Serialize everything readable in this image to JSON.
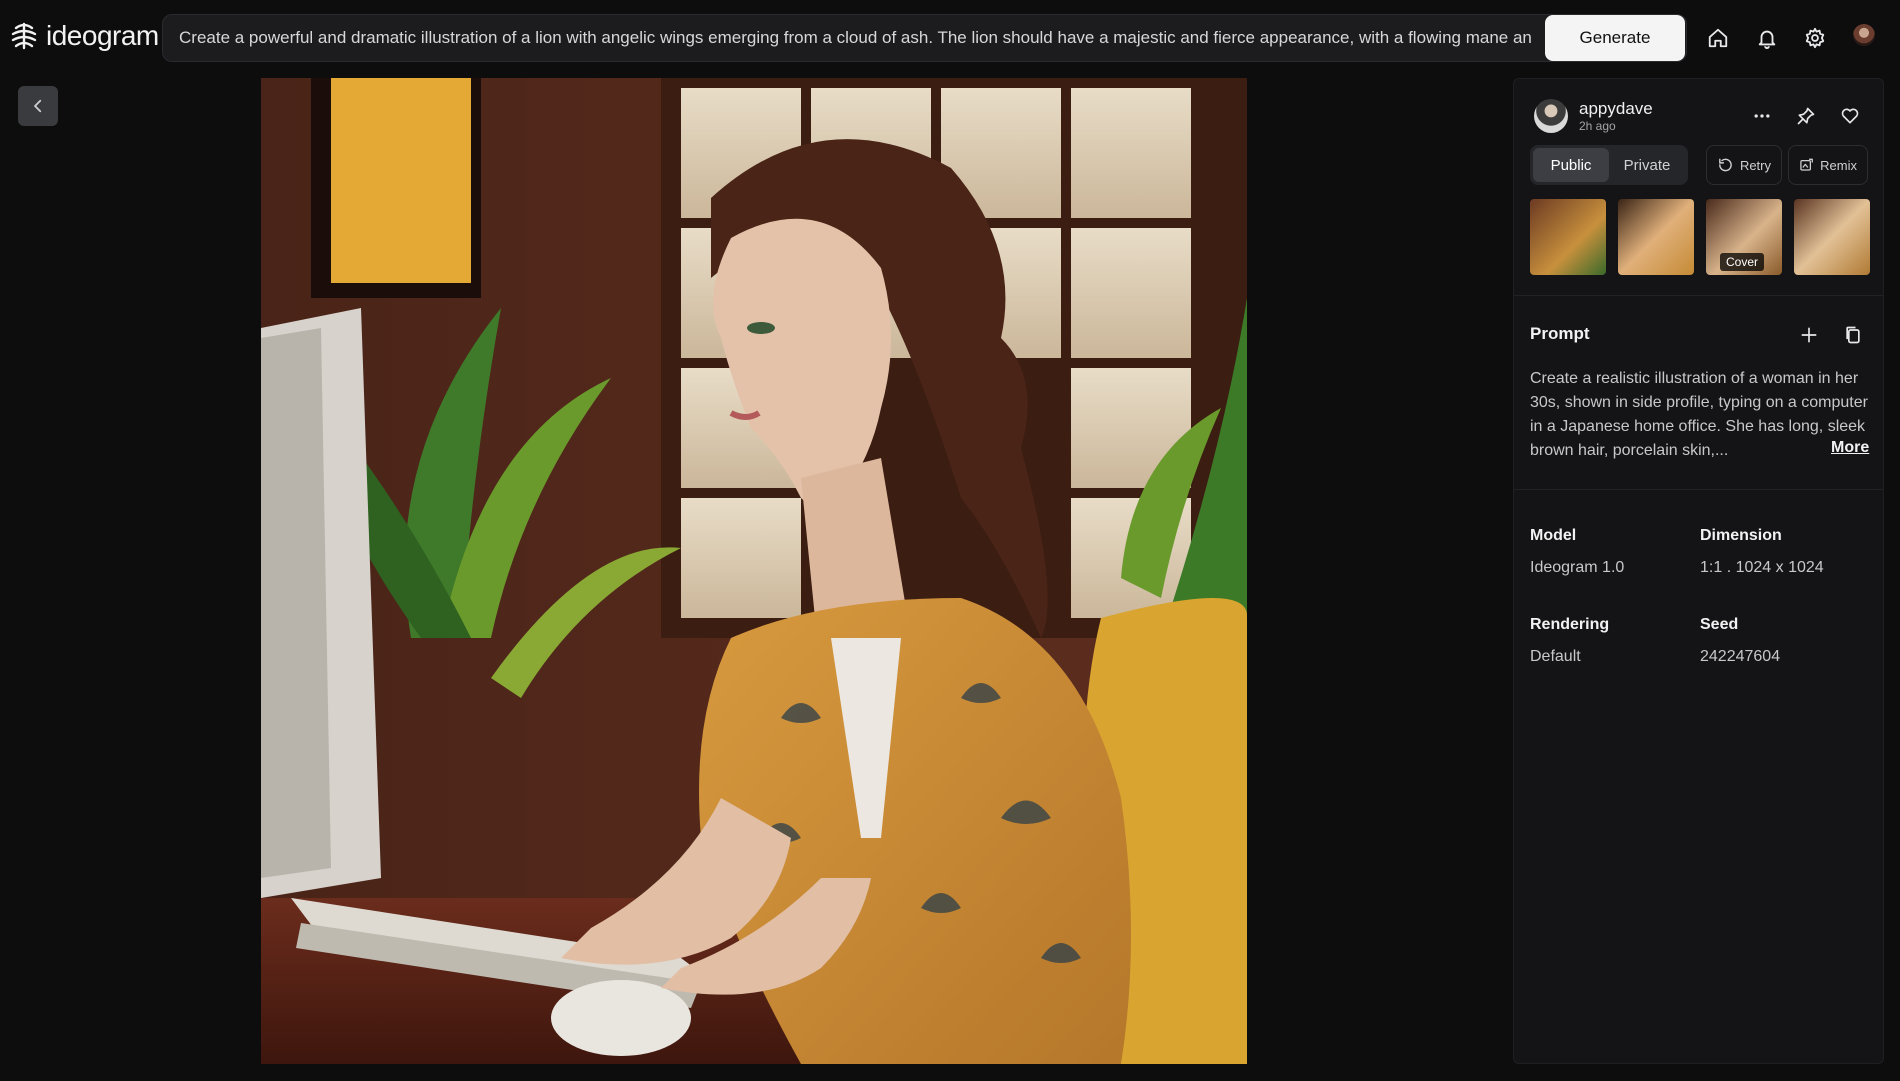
{
  "app": {
    "logo_text": "ideogram"
  },
  "topbar": {
    "prompt_value": "Create a powerful and dramatic illustration of a lion with angelic wings emerging from a cloud of ash. The lion should have a majestic and fierce appearance, with a flowing mane and detail",
    "generate_label": "Generate",
    "icons": [
      "home-icon",
      "bell-icon",
      "gear-icon",
      "avatar"
    ]
  },
  "panel": {
    "username": "appydave",
    "timeago": "2h ago",
    "visibility": {
      "public_label": "Public",
      "private_label": "Private",
      "selected": "Public"
    },
    "retry_label": "Retry",
    "remix_label": "Remix",
    "thumbnails": [
      {
        "label": ""
      },
      {
        "label": ""
      },
      {
        "label": "Cover"
      },
      {
        "label": ""
      }
    ],
    "prompt_heading": "Prompt",
    "prompt_text": "Create a realistic illustration of a woman in her 30s, shown in side profile, typing on a computer in a Japanese home office. She has long, sleek brown hair, porcelain skin,...",
    "more_label": "More",
    "meta": {
      "model_label": "Model",
      "model_value": "Ideogram 1.0",
      "dimension_label": "Dimension",
      "dimension_value": "1:1 . 1024 x 1024",
      "rendering_label": "Rendering",
      "rendering_value": "Default",
      "seed_label": "Seed",
      "seed_value": "242247604"
    }
  },
  "colors": {
    "background": "#0d0d0e",
    "panel": "#141416",
    "accent_button": "#f4f4f5"
  }
}
